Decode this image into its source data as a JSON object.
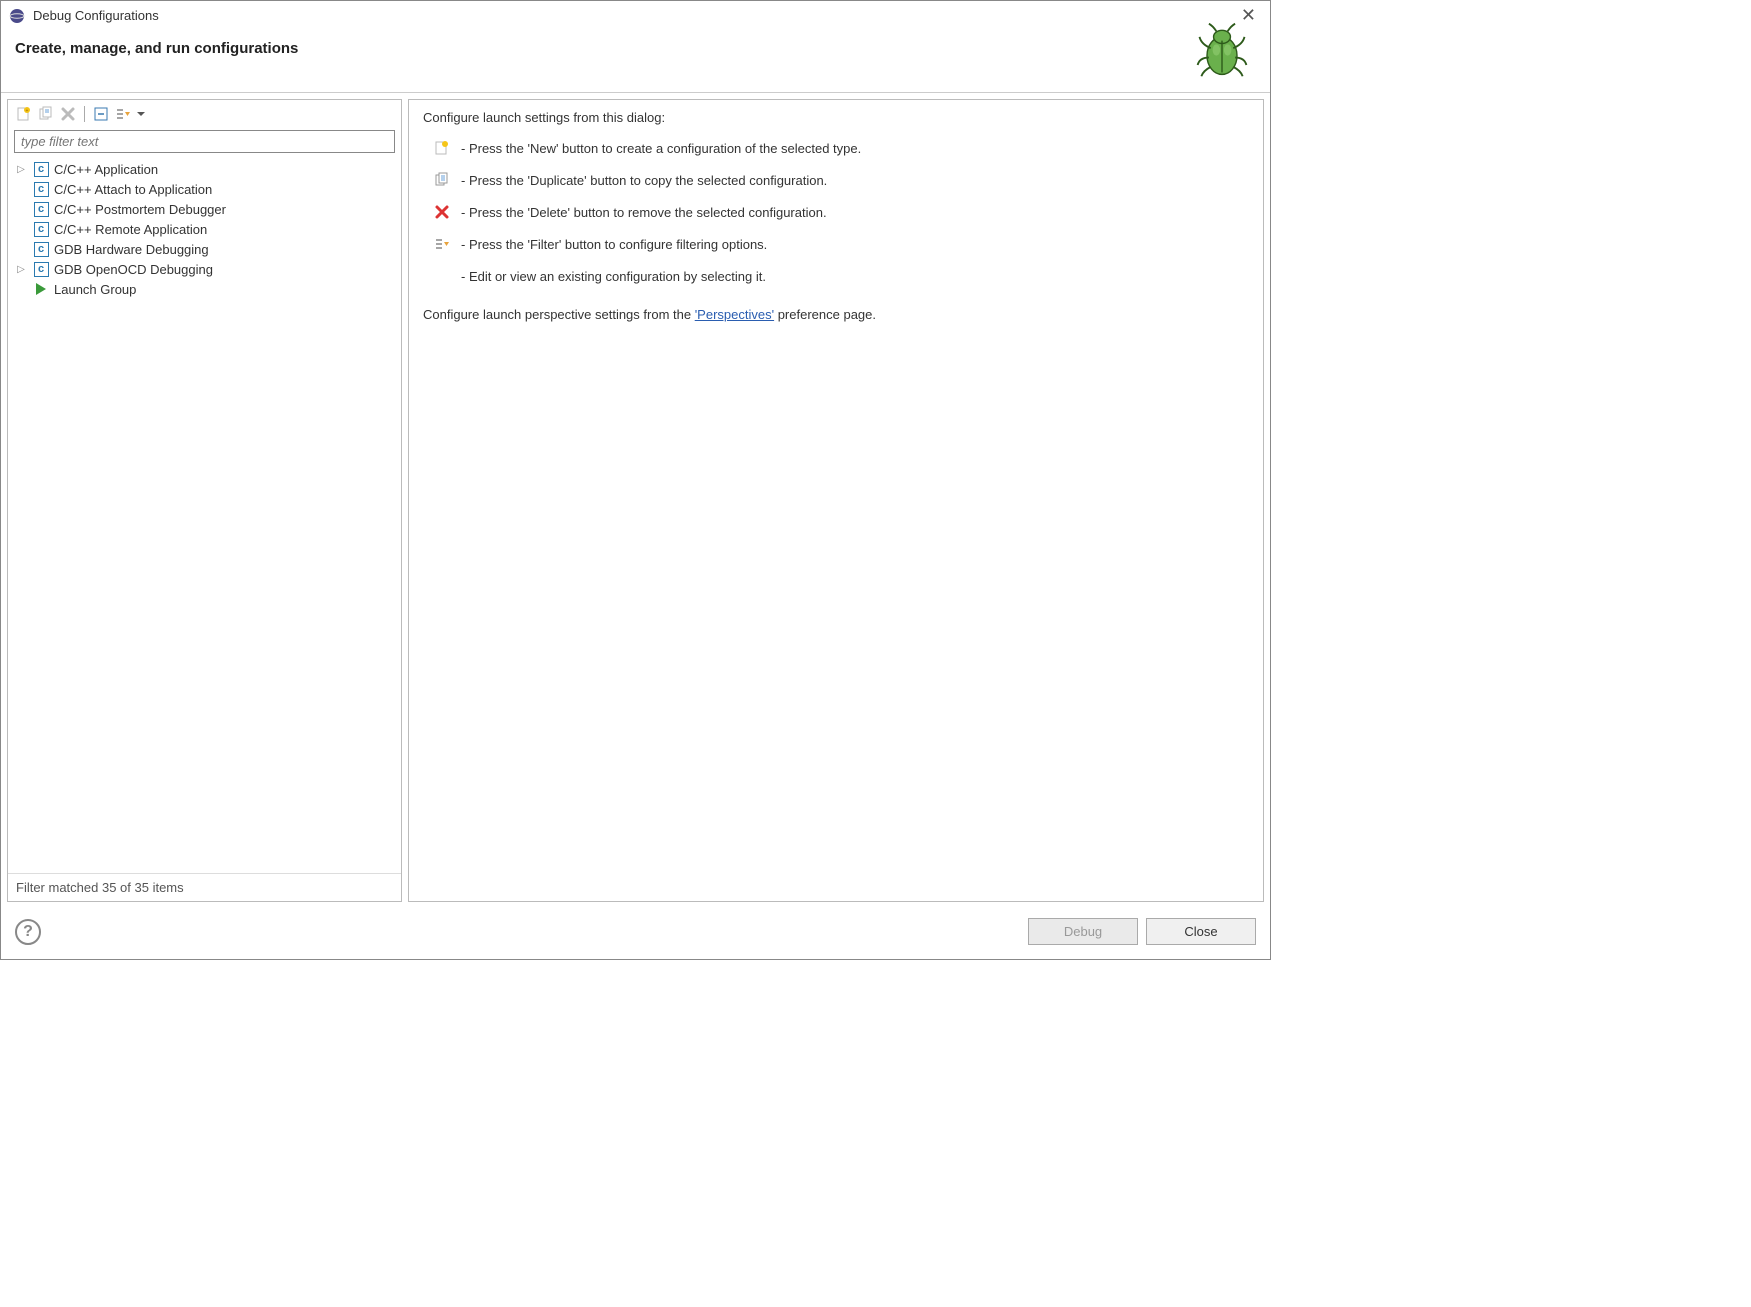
{
  "window": {
    "title": "Debug Configurations"
  },
  "header": {
    "subtitle": "Create, manage, and run configurations"
  },
  "filter": {
    "placeholder": "type filter text"
  },
  "tree": {
    "items": [
      {
        "label": "C/C++ Application",
        "icon": "c",
        "expandable": true
      },
      {
        "label": "C/C++ Attach to Application",
        "icon": "c",
        "expandable": false
      },
      {
        "label": "C/C++ Postmortem Debugger",
        "icon": "c",
        "expandable": false
      },
      {
        "label": "C/C++ Remote Application",
        "icon": "c",
        "expandable": false
      },
      {
        "label": "GDB Hardware Debugging",
        "icon": "c",
        "expandable": false
      },
      {
        "label": "GDB OpenOCD Debugging",
        "icon": "c",
        "expandable": true
      },
      {
        "label": "Launch Group",
        "icon": "play",
        "expandable": false
      }
    ],
    "status": "Filter matched 35 of 35 items"
  },
  "rightPanel": {
    "intro": "Configure launch settings from this dialog:",
    "lines": [
      " - Press the 'New' button to create a configuration of the selected type.",
      " - Press the 'Duplicate' button to copy the selected configuration.",
      " - Press the 'Delete' button to remove the selected configuration.",
      " - Press the 'Filter' button to configure filtering options.",
      " - Edit or view an existing configuration by selecting it."
    ],
    "secondIntro_before": "Configure launch perspective settings from the ",
    "secondIntro_link": "'Perspectives'",
    "secondIntro_after": " preference page."
  },
  "footer": {
    "debug": "Debug",
    "close": "Close"
  },
  "icons": {
    "new": "new-file-icon",
    "duplicate": "duplicate-icon",
    "delete": "delete-icon",
    "collapse": "collapse-all-icon",
    "filter": "filter-icon"
  }
}
